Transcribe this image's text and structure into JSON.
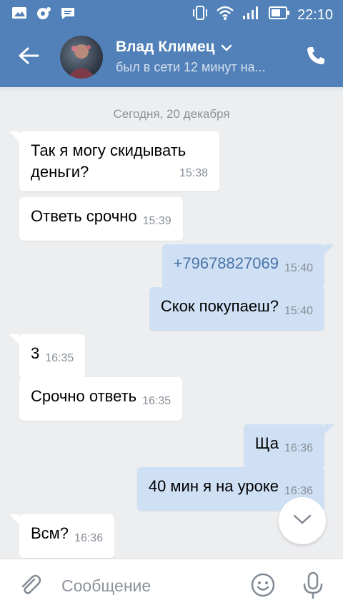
{
  "status_bar": {
    "time": "22:10"
  },
  "header": {
    "name": "Влад Климец",
    "status": "был в сети 12 минут на..."
  },
  "chat": {
    "date": "Сегодня, 20 декабря",
    "messages": [
      {
        "dir": "in",
        "line1": "Так я могу скидывать",
        "line2": "деньги?",
        "time": "15:38"
      },
      {
        "dir": "in",
        "text": "Ответь срочно",
        "time": "15:39"
      },
      {
        "dir": "out",
        "text": "+79678827069",
        "time": "15:40"
      },
      {
        "dir": "out",
        "text": "Скок покупаеш?",
        "time": "15:40"
      },
      {
        "dir": "in",
        "text": "3",
        "time": "16:35"
      },
      {
        "dir": "in",
        "text": "Срочно ответь",
        "time": "16:35"
      },
      {
        "dir": "out",
        "text": "Ща",
        "time": "16:36"
      },
      {
        "dir": "out",
        "text": "40 мин я на уроке",
        "time": "16:36"
      },
      {
        "dir": "in",
        "text": "Всм?",
        "time": "16:36"
      }
    ]
  },
  "composer": {
    "placeholder": "Сообщение"
  },
  "colors": {
    "brand": "#5181b8",
    "out_bubble": "#cfe0f5",
    "background": "#edeef0"
  },
  "icons": [
    "image-icon",
    "notification-icon",
    "chat-icon",
    "vibrate-icon",
    "wifi-icon",
    "signal-icon",
    "battery-icon",
    "back-arrow-icon",
    "chevron-down-icon",
    "phone-icon",
    "chevron-down-icon",
    "paperclip-icon",
    "emoji-icon",
    "microphone-icon"
  ]
}
